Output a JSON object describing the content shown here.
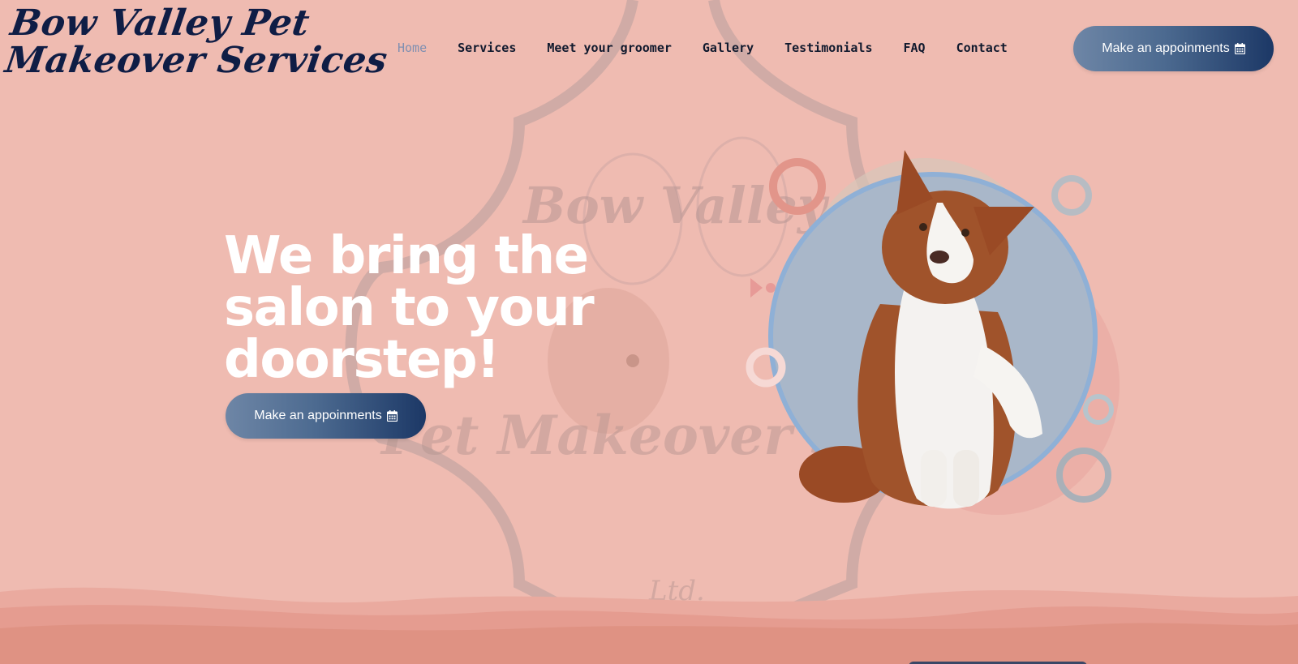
{
  "brand": {
    "line1": "Bow Valley Pet",
    "line2": "Makeover Services"
  },
  "nav": {
    "items": [
      {
        "label": "Home",
        "active": true
      },
      {
        "label": "Services"
      },
      {
        "label": "Meet your groomer"
      },
      {
        "label": "Gallery"
      },
      {
        "label": "Testimonials"
      },
      {
        "label": "FAQ"
      },
      {
        "label": "Contact"
      }
    ]
  },
  "header_cta": {
    "label": "Make an appoinments",
    "icon": "calendar-icon"
  },
  "hero": {
    "title": "We bring the salon to your doorstep!",
    "cta_label": "Make an appoinments",
    "cta_icon": "calendar-icon"
  },
  "watermark": {
    "line1": "Bow Valley",
    "line2": "Pet Makeover Se",
    "suffix": "Ltd."
  },
  "colors": {
    "background": "#efbbb1",
    "brand_text": "#0f1d45",
    "nav_active": "#7f8fb1",
    "button_start": "#6e86a6",
    "button_end": "#1c3866"
  }
}
